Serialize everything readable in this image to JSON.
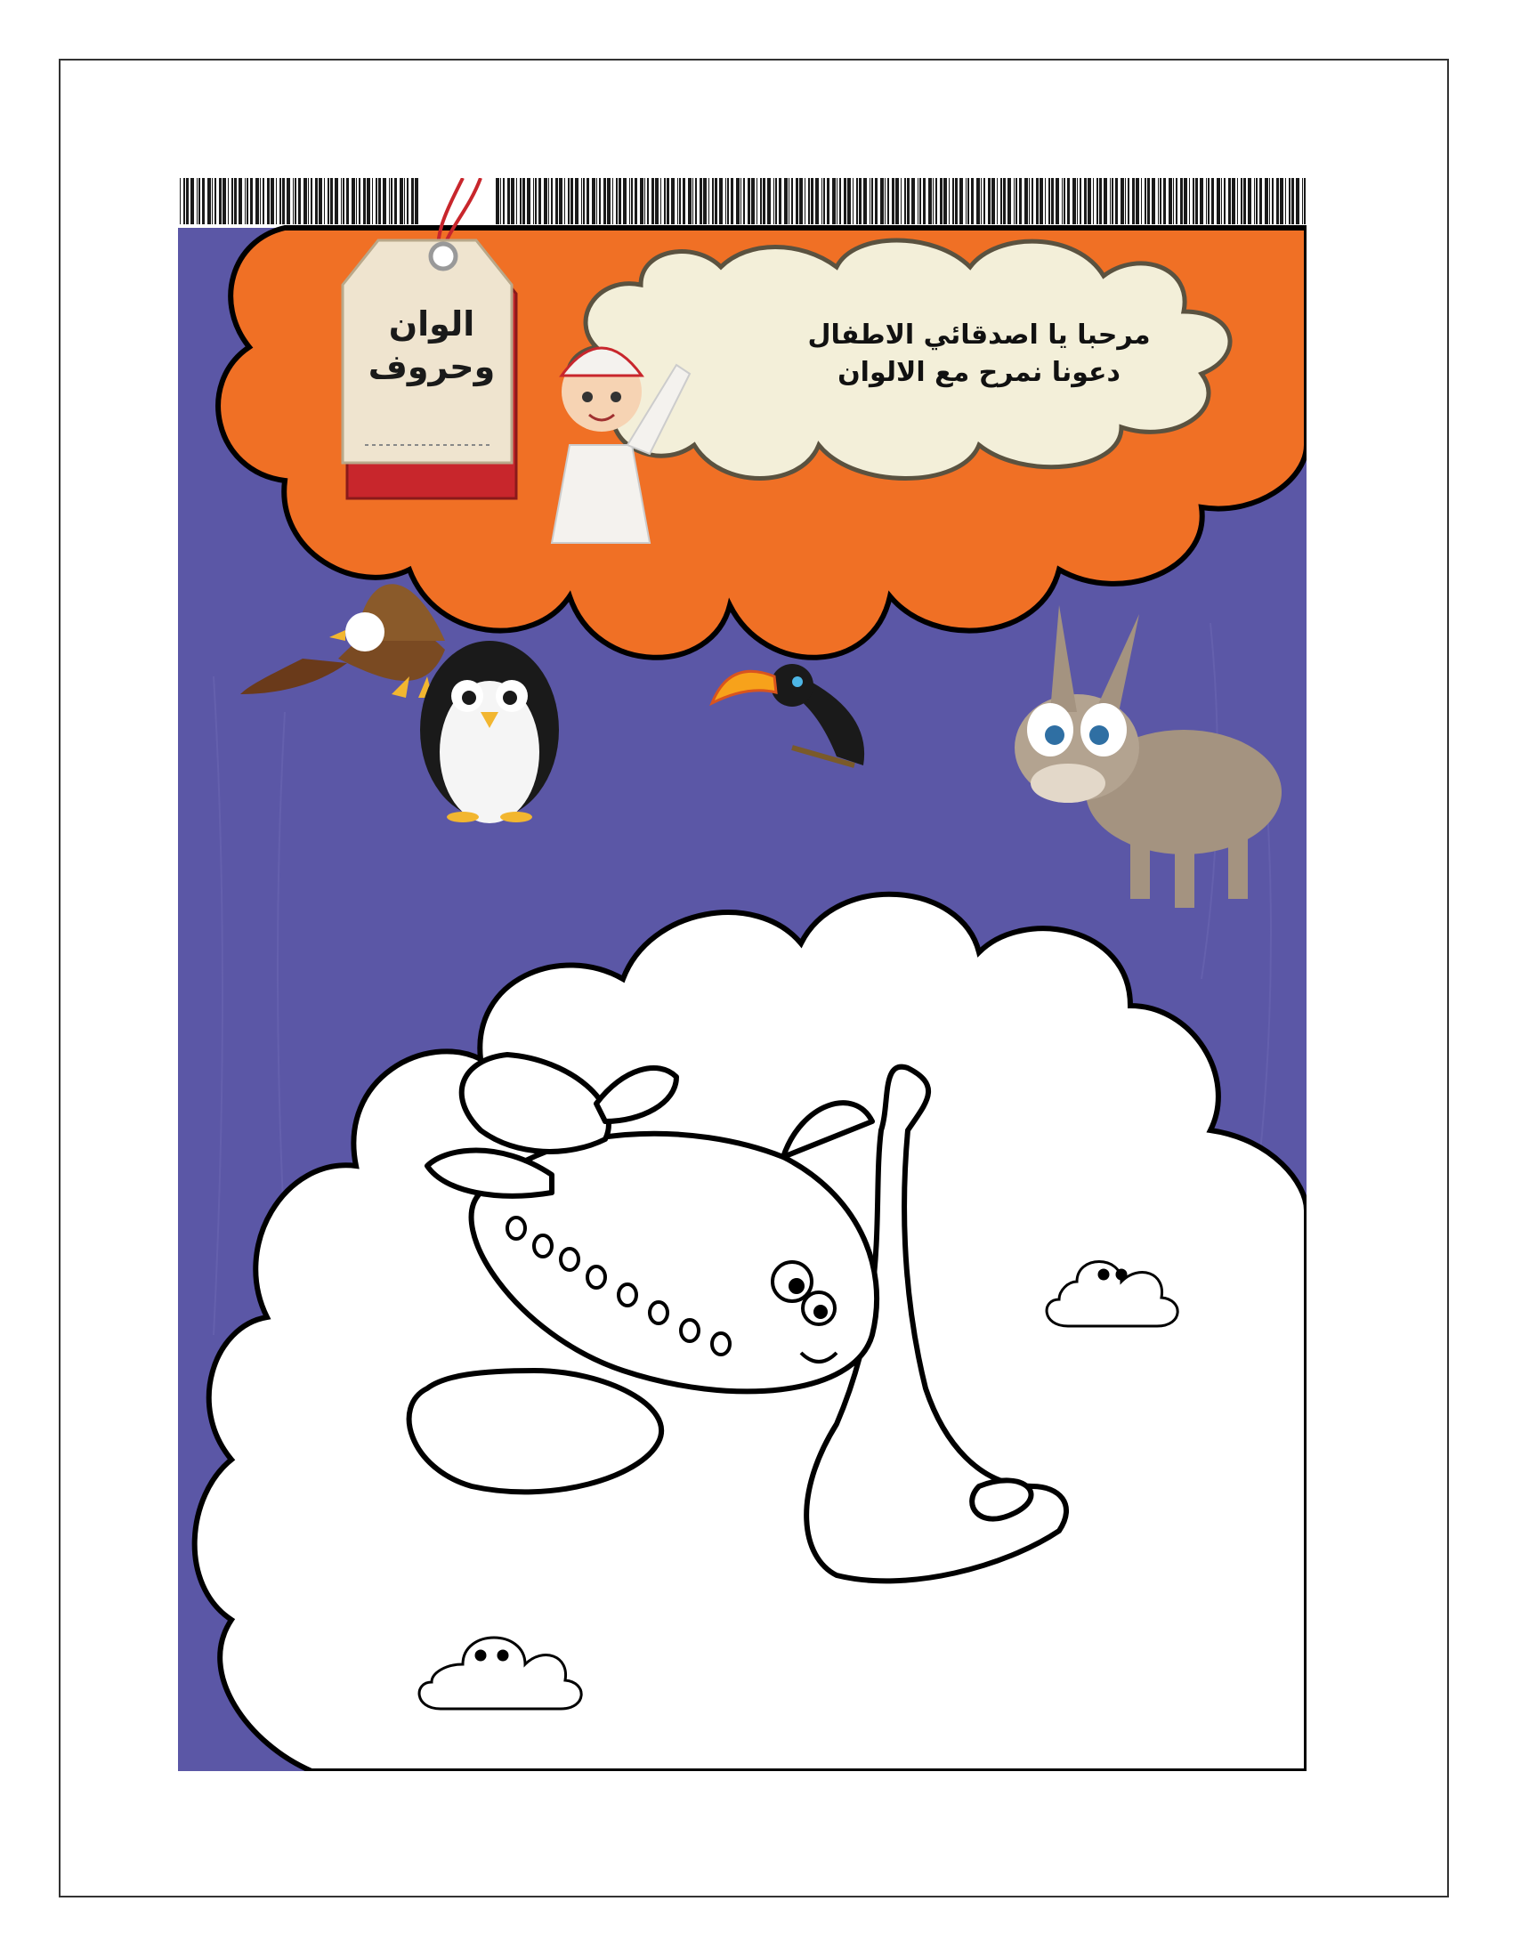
{
  "tag": {
    "line1": "الوان",
    "line2": "وحروف"
  },
  "greeting": {
    "line1": "مرحبا يا اصدقائي الاطفال",
    "line2": "دعونا نمرح مع الالوان"
  },
  "coloring_letter": "ط",
  "colors": {
    "background_purple": "#5b57a6",
    "cloud_orange": "#f07025",
    "cloud_cream": "#f3efd9",
    "tag_red": "#c8262c",
    "tag_cream": "#efe4cf",
    "outline": "#000000"
  },
  "illustrations": [
    "barcode-strip",
    "hang-tag",
    "boy-waving",
    "eagle",
    "penguin",
    "toucan",
    "donkey",
    "letter-taa-airplane",
    "small-cloud-face"
  ]
}
